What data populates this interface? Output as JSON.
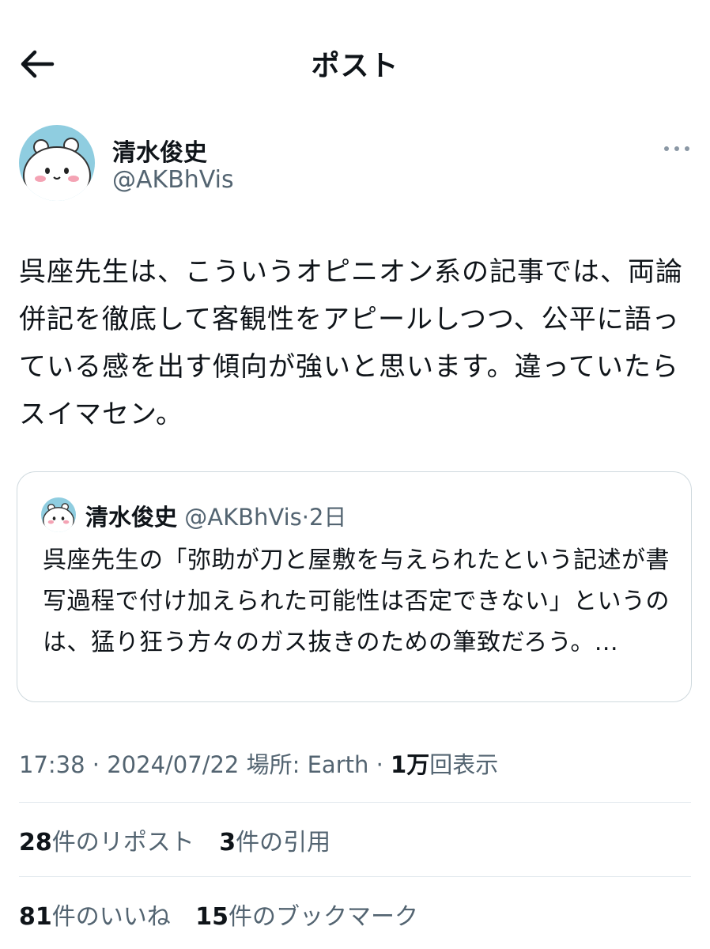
{
  "header": {
    "title": "ポスト",
    "back_icon": "arrow-left-icon"
  },
  "author": {
    "name": "清水俊史",
    "handle": "@AKBhVis"
  },
  "post": {
    "text": "呉座先生は、こういうオピニオン系の記事では、両論併記を徹底して客観性をアピールしつつ、公平に語っている感を出す傾向が強いと思います。違っていたらスイマセン。"
  },
  "quote": {
    "name": "清水俊史",
    "handle": "@AKBhVis",
    "separator": "·",
    "time": "2日",
    "text": "呉座先生の「弥助が刀と屋敷を与えられたという記述が書写過程で付け加えられた可能性は否定できない」というのは、猛り狂う方々のガス抜きのための筆致だろう。..."
  },
  "meta": {
    "time": "17:38",
    "separator": "·",
    "date": "2024/07/22",
    "location": "場所: Earth",
    "views_count": "1万",
    "views_label": "回表示"
  },
  "stats": {
    "reposts_count": "28",
    "reposts_label": "件のリポスト",
    "quotes_count": "3",
    "quotes_label": "件の引用",
    "likes_count": "81",
    "likes_label": "件のいいね",
    "bookmarks_count": "15",
    "bookmarks_label": "件のブックマーク"
  },
  "colors": {
    "text": "#0f1419",
    "secondary": "#536471",
    "border": "#cfd9de",
    "avatar_bg": "#8fcde0"
  }
}
